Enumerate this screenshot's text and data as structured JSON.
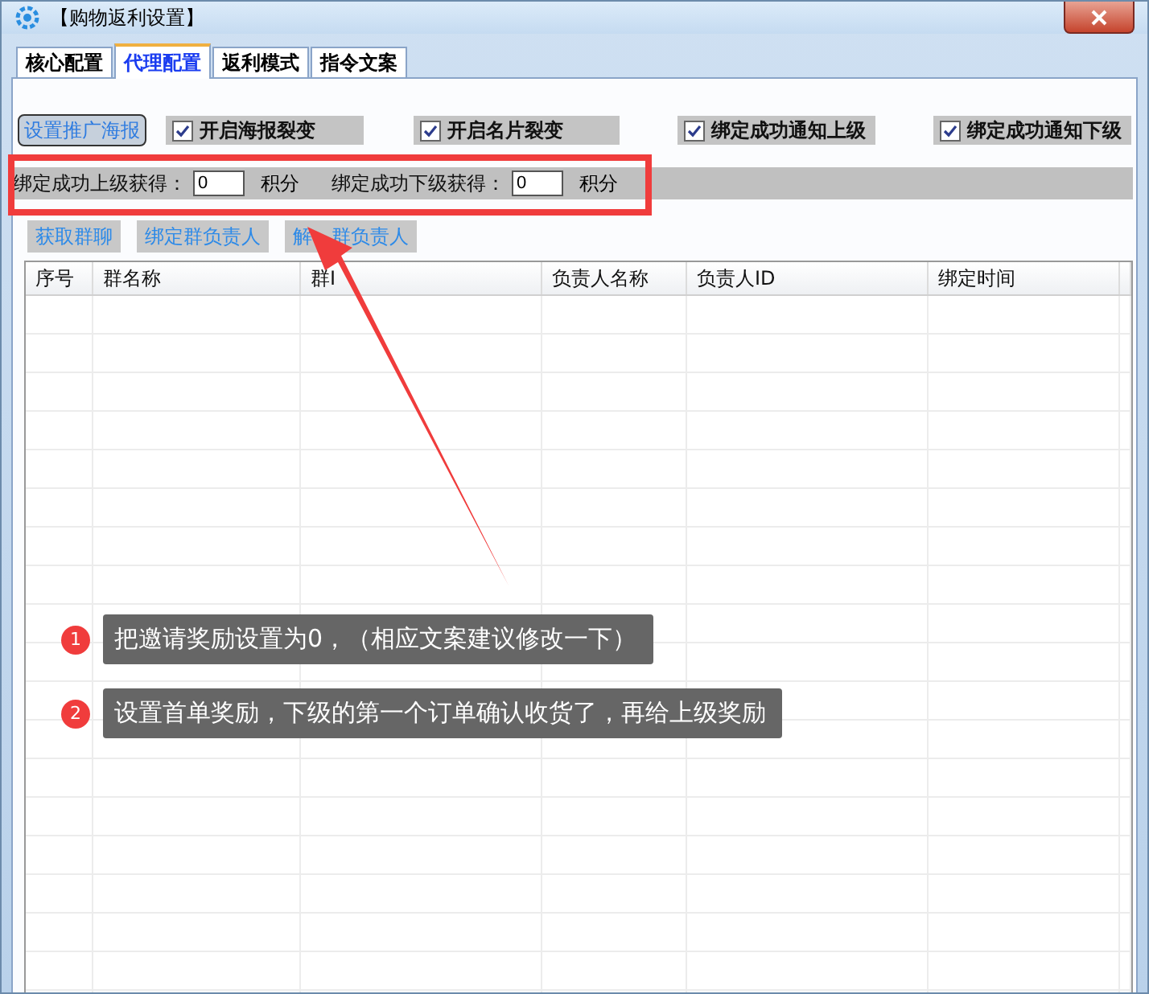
{
  "window": {
    "title": "【购物返利设置】"
  },
  "tabs": [
    {
      "label": "核心配置",
      "selected": false
    },
    {
      "label": "代理配置",
      "selected": true
    },
    {
      "label": "返利模式",
      "selected": false
    },
    {
      "label": "指令文案",
      "selected": false
    }
  ],
  "toolbar": {
    "button": "设置推广海报",
    "checkboxes": [
      {
        "label": "开启海报裂变",
        "checked": true
      },
      {
        "label": "开启名片裂变",
        "checked": true
      },
      {
        "label": "绑定成功通知上级",
        "checked": true
      },
      {
        "label": "绑定成功通知下级",
        "checked": true
      }
    ]
  },
  "reward_bar": {
    "highlighted": true,
    "fields": [
      {
        "label": "绑定成功上级获得：",
        "value": "0",
        "unit": "积分"
      },
      {
        "label": "绑定成功下级获得：",
        "value": "0",
        "unit": "积分"
      }
    ]
  },
  "actions": [
    "获取群聊",
    "绑定群负责人",
    "解　群负责人"
  ],
  "table": {
    "columns": [
      "序号",
      "群名称",
      "群I",
      "负责人名称",
      "负责人ID",
      "绑定时间"
    ]
  },
  "annotations": [
    {
      "number": "1",
      "text": "把邀请奖励设置为0，（相应文案建议修改一下）"
    },
    {
      "number": "2",
      "text": "设置首单奖励，下级的第一个订单确认收货了，再给上级奖励"
    }
  ]
}
